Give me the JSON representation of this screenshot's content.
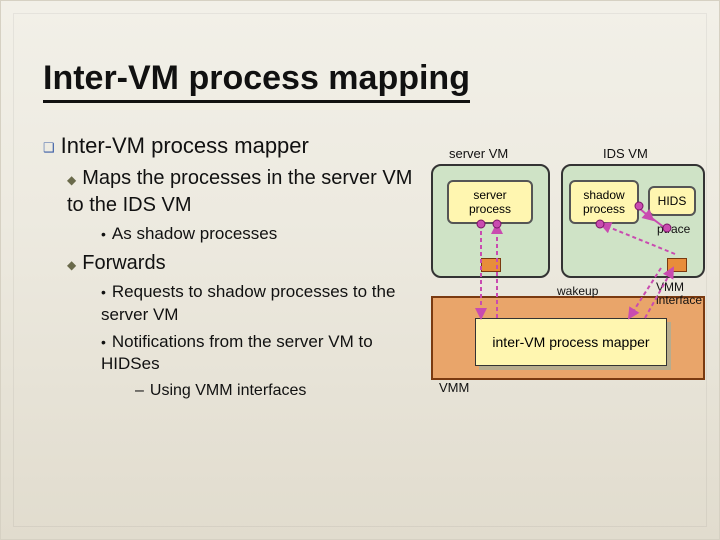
{
  "title": "Inter-VM process mapping",
  "bullets": {
    "b0": "Inter-VM process mapper",
    "b1": "Maps the processes in the server VM to the IDS VM",
    "b1a": "As shadow processes",
    "b2": "Forwards",
    "b2a": "Requests to shadow processes to the server VM",
    "b2b": "Notifications from the server VM to HIDSes",
    "b2b1": "Using VMM interfaces"
  },
  "diagram": {
    "server_vm": "server VM",
    "ids_vm": "IDS VM",
    "server_process": "server process",
    "shadow_process": "shadow process",
    "hids": "HIDS",
    "ptrace": "ptrace",
    "wakeup": "wakeup",
    "vmm_interface": "VMM interface",
    "mapper": "inter-VM process mapper",
    "vmm": "VMM"
  }
}
